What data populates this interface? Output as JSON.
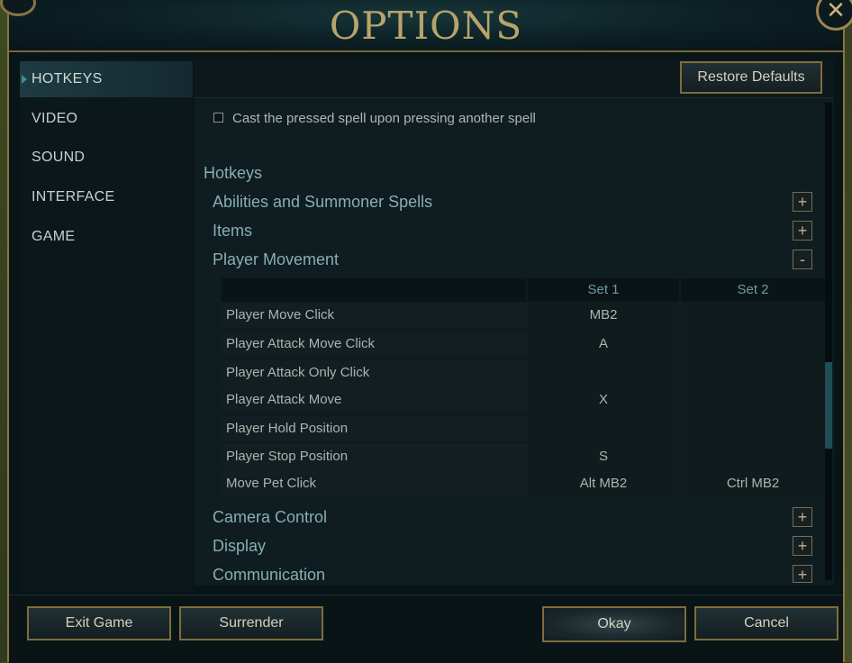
{
  "window": {
    "title": "OPTIONS"
  },
  "sidebar": {
    "items": [
      {
        "label": "HOTKEYS",
        "active": true
      },
      {
        "label": "VIDEO"
      },
      {
        "label": "SOUND"
      },
      {
        "label": "INTERFACE"
      },
      {
        "label": "GAME"
      }
    ]
  },
  "toolbar": {
    "restore_label": "Restore Defaults"
  },
  "settings": {
    "cast_option_label": "Cast the pressed spell upon pressing another spell",
    "cast_option_checked": false
  },
  "hotkeys": {
    "section_title": "Hotkeys",
    "categories": [
      {
        "label": "Abilities and Summoner Spells",
        "toggle": "+"
      },
      {
        "label": "Items",
        "toggle": "+"
      },
      {
        "label": "Player Movement",
        "toggle": "-"
      },
      {
        "label": "Camera Control",
        "toggle": "+"
      },
      {
        "label": "Display",
        "toggle": "+"
      },
      {
        "label": "Communication",
        "toggle": "+"
      }
    ],
    "table": {
      "headers": [
        "",
        "Set 1",
        "Set 2"
      ],
      "rows": [
        {
          "name": "Player Move Click",
          "set1": "MB2",
          "set2": ""
        },
        {
          "name": "Player Attack Move Click",
          "set1": "A",
          "set2": ""
        },
        {
          "name": "Player Attack Only Click",
          "set1": "",
          "set2": ""
        },
        {
          "name": "Player Attack Move",
          "set1": "X",
          "set2": ""
        },
        {
          "name": "Player Hold Position",
          "set1": "",
          "set2": ""
        },
        {
          "name": "Player Stop Position",
          "set1": "S",
          "set2": ""
        },
        {
          "name": "Move Pet Click",
          "set1": "Alt MB2",
          "set2": "Ctrl MB2"
        }
      ]
    }
  },
  "footer": {
    "exit_label": "Exit Game",
    "surrender_label": "Surrender",
    "okay_label": "Okay",
    "cancel_label": "Cancel"
  },
  "colors": {
    "accent_gold": "#b8a36a",
    "text_teal": "#87aeb3",
    "panel_bg": "#0f1c20"
  },
  "icons": {
    "close": "close-icon",
    "active_marker": "triangle-right-icon"
  }
}
